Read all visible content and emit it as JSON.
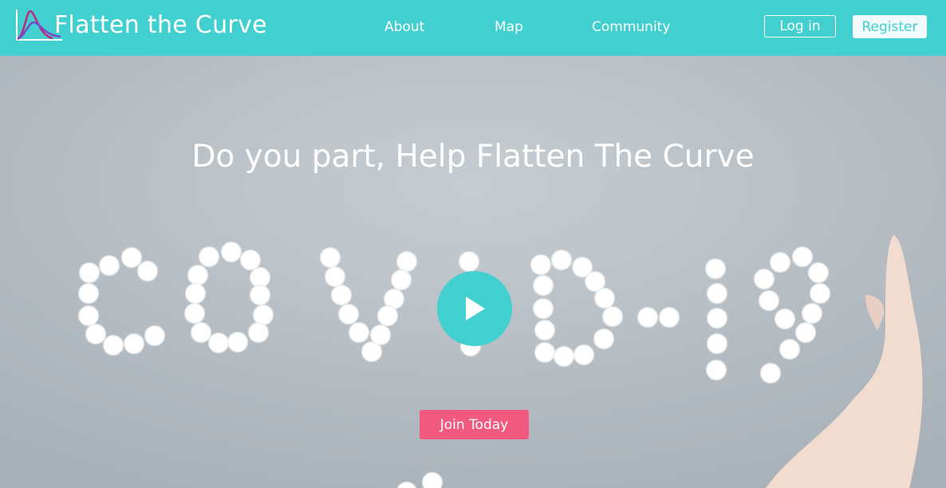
{
  "brand": {
    "name": "Flatten the Curve",
    "logo_icon": "curve-chart-icon"
  },
  "nav": {
    "items": [
      {
        "label": "About"
      },
      {
        "label": "Map"
      },
      {
        "label": "Community"
      }
    ]
  },
  "auth": {
    "login_label": "Log in",
    "register_label": "Register"
  },
  "hero": {
    "headline": "Do you part, Help Flatten The Curve",
    "background_text": "covid-19",
    "play_icon": "play-icon",
    "cta_label": "Join Today"
  },
  "colors": {
    "navbar": "#41cfcf",
    "accent": "#41cfcf",
    "cta": "#f15a7e",
    "hero_bg": "#b9c2c8",
    "logo_curve_1": "#c0287e",
    "logo_curve_2": "#7a48c8"
  }
}
